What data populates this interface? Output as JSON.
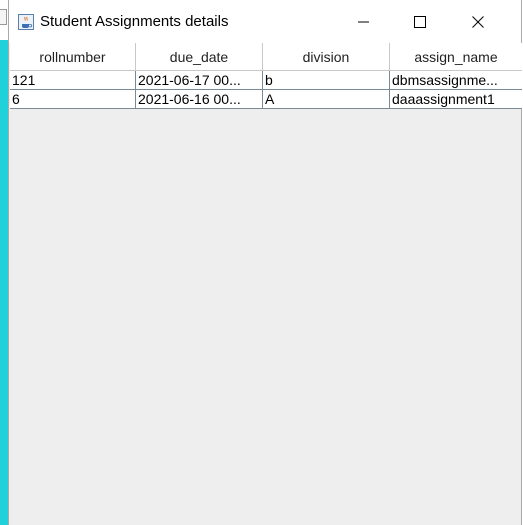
{
  "window": {
    "title": "Student Assignments details",
    "icon": "java-cup-icon"
  },
  "controls": {
    "minimize": "minimize-icon",
    "maximize": "maximize-icon",
    "close": "close-icon"
  },
  "table": {
    "columns": [
      "rollnumber",
      "due_date",
      "division",
      "assign_name"
    ],
    "rows": [
      [
        "121",
        "2021-06-17 00...",
        "b",
        "dbmsassignme..."
      ],
      [
        "6",
        "2021-06-16 00...",
        "A",
        "daaassignment1"
      ]
    ]
  },
  "colors": {
    "accent_left_strip": "#1fd1d8",
    "content_bg": "#eeeeee",
    "grid": "#7a8a99"
  }
}
